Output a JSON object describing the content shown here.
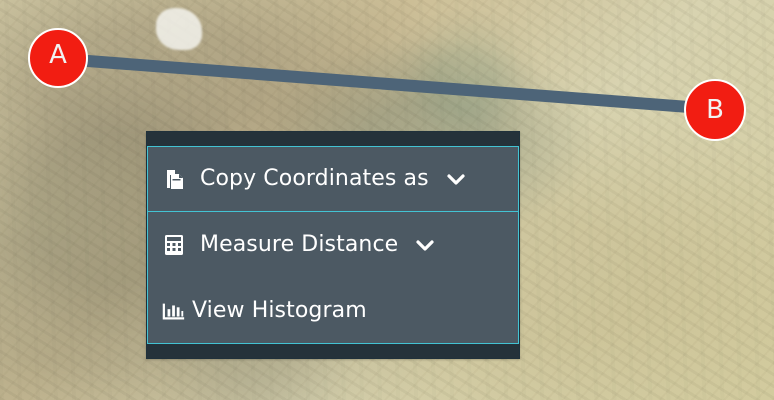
{
  "map": {
    "marker_a_label": "A",
    "marker_b_label": "B",
    "route_color": "#4d6478",
    "marker_color": "#f21d12"
  },
  "context_menu": {
    "items": [
      {
        "icon": "copy-icon",
        "label": "Copy Coordinates as",
        "has_submenu": true
      },
      {
        "icon": "calculator-icon",
        "label": "Measure Distance",
        "has_submenu": true
      },
      {
        "icon": "histogram-icon",
        "label": "View Histogram",
        "has_submenu": false
      }
    ],
    "accent_border_color": "#43c3d3",
    "background_color": "#4c5963"
  }
}
